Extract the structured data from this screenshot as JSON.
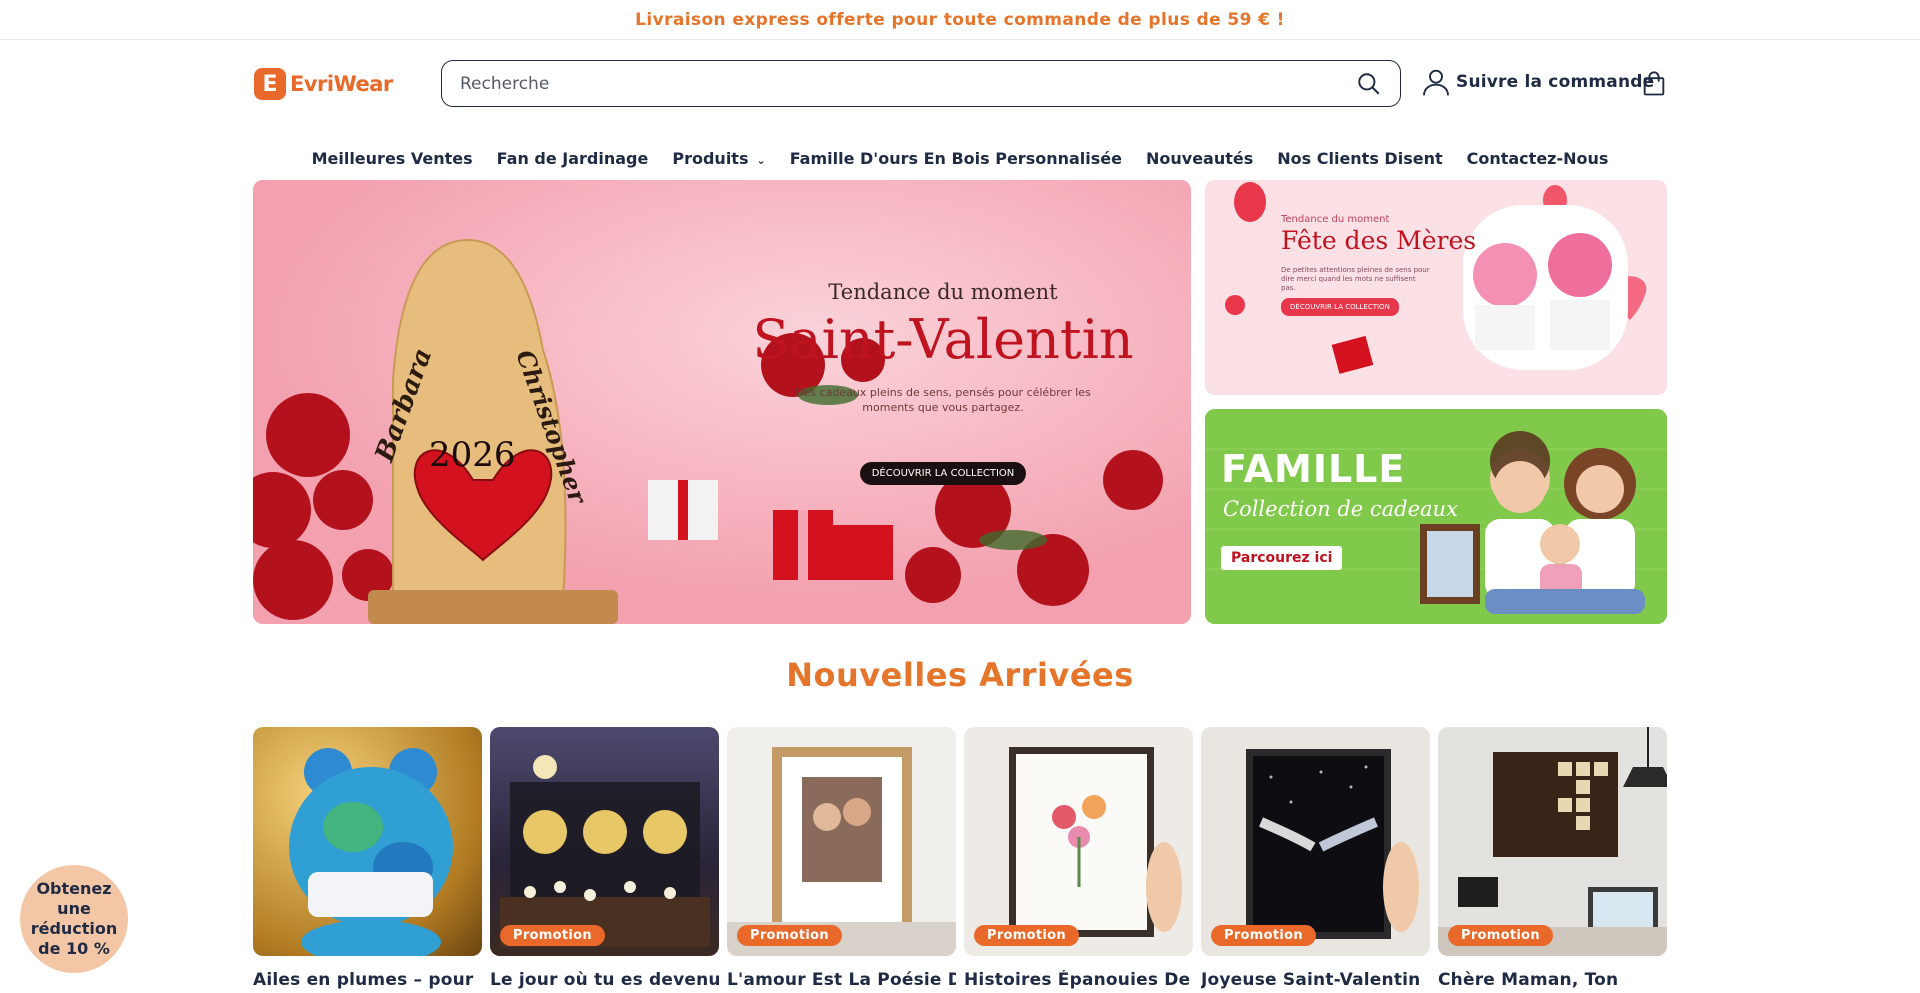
{
  "announcement": "Livraison express offerte pour toute commande de plus de 59 € !",
  "header": {
    "logo_text": "EvriWear",
    "search_placeholder": "Recherche",
    "track_order": "Suivre la commande"
  },
  "nav": [
    {
      "label": "Meilleures Ventes"
    },
    {
      "label": "Fan de Jardinage"
    },
    {
      "label": "Produits"
    },
    {
      "label": "Famille D'ours En Bois Personnalisée"
    },
    {
      "label": "Nouveautés"
    },
    {
      "label": "Nos Clients Disent"
    },
    {
      "label": "Contactez-Nous"
    }
  ],
  "hero": {
    "kicker": "Tendance du moment",
    "title": "Saint-Valentin",
    "subtitle": "Des cadeaux pleins de sens, pensés pour célébrer les moments que vous partagez.",
    "cta": "DÉCOUVRIR LA COLLECTION",
    "bear_names": [
      "Barbara",
      "Christopher"
    ],
    "bear_year": "2026"
  },
  "side1": {
    "kicker": "Tendance du moment",
    "title": "Fête des Mères",
    "text": "De petites attentions pleines de sens pour dire merci quand les mots ne suffisent pas.",
    "cta": "DÉCOUVRIR LA COLLECTION"
  },
  "side2": {
    "title": "FAMILLE",
    "script": "Collection de cadeaux",
    "cta": "Parcourez ici"
  },
  "section_title": "Nouvelles Arrivées",
  "products": [
    {
      "title": "Ailes en plumes – pour",
      "badge": ""
    },
    {
      "title": "Le jour où tu es devenue",
      "badge": "Promotion"
    },
    {
      "title": "L'amour Est La Poésie Des",
      "badge": "Promotion"
    },
    {
      "title": "Histoires Épanouies De",
      "badge": "Promotion"
    },
    {
      "title": "Joyeuse Saint-Valentin",
      "badge": "Promotion"
    },
    {
      "title": "Chère Maman, Ton",
      "badge": "Promotion"
    }
  ],
  "discount_popup": "Obtenez une réduction de 10 %",
  "colors": {
    "accent": "#e8692a",
    "text": "#1f2a44"
  }
}
